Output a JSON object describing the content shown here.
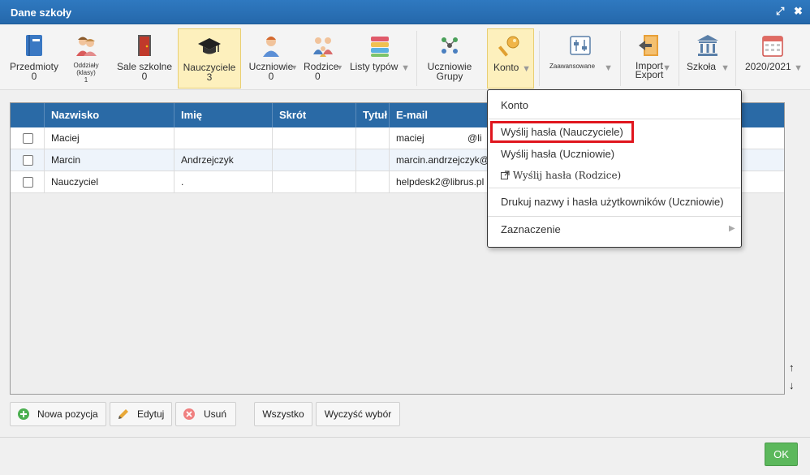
{
  "window": {
    "title": "Dane szkoły",
    "expand_glyph": "⤢",
    "close_glyph": "✖"
  },
  "toolbar": {
    "items": [
      {
        "label": "Przedmioty",
        "count": "0"
      },
      {
        "label": "Oddziały",
        "sub": "(klasy)",
        "count": "1"
      },
      {
        "label": "Sale szkolne",
        "count": "0"
      },
      {
        "label": "Nauczyciele",
        "count": "3"
      },
      {
        "label": "Uczniowie",
        "count": "0"
      },
      {
        "label": "Rodzice",
        "count": "0"
      },
      {
        "label": "Listy typów"
      },
      {
        "label": "Uczniowie",
        "line2": "Grupy"
      },
      {
        "label": "Konto"
      },
      {
        "label": "Zaawansowane"
      },
      {
        "label": "Import",
        "line2": "Export"
      },
      {
        "label": "Szkoła"
      },
      {
        "label": "2020/2021"
      }
    ],
    "dropdown_glyph": "▼"
  },
  "grid": {
    "columns": [
      "Nazwisko",
      "Imię",
      "Skrót",
      "Tytuł",
      "E-mail"
    ],
    "rows": [
      {
        "nazwisko": "Maciej",
        "imie": "",
        "skrot": "",
        "tytul": "",
        "email": "maciej                @li"
      },
      {
        "nazwisko": "Marcin",
        "imie": "Andrzejczyk",
        "skrot": "",
        "tytul": "",
        "email": "marcin.andrzejczyk@"
      },
      {
        "nazwisko": "Nauczyciel",
        "imie": ".",
        "skrot": "",
        "tytul": "",
        "email": "helpdesk2@librus.pl"
      }
    ]
  },
  "scroll": {
    "up": "↑",
    "down": "↓"
  },
  "buttons": {
    "new": "Nowa pozycja",
    "edit": "Edytuj",
    "delete": "Usuń",
    "all": "Wszystko",
    "clear": "Wyczyść wybór",
    "ok": "OK"
  },
  "menu": {
    "konto": "Konto",
    "send_teachers": "Wyślij hasła (Nauczyciele)",
    "send_students": "Wyślij hasła (Uczniowie)",
    "send_parents": "Wyślij hasła (Rodzice)",
    "print_names": "Drukuj nazwy i hasła użytkowników (Uczniowie)",
    "selection": "Zaznaczenie",
    "submenu_glyph": "▶"
  },
  "colors": {
    "header_blue": "#2a6aa6",
    "active_tab": "#fdf0bd",
    "ok_green": "#5cb85c",
    "highlight_red": "#e0161e"
  }
}
